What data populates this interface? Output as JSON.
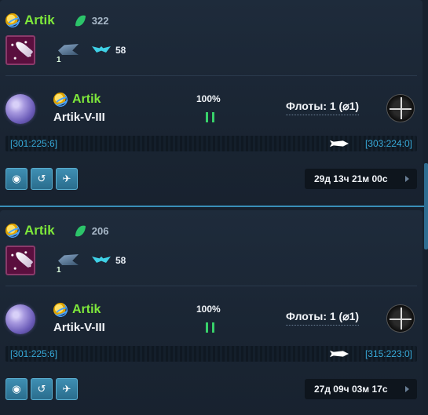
{
  "colors": {
    "owner_green": "#7ee83b",
    "coord_blue": "#37a9d8",
    "pause_green": "#38d16a",
    "action_button": "#3f8fb3",
    "separator": "#3a8fb8"
  },
  "missions": [
    {
      "owner": {
        "icon": "alliance-star-icon",
        "name": "Artik"
      },
      "resource": {
        "icon": "leaf-icon",
        "value": "322"
      },
      "badge_icon": "comet-badge-icon",
      "ship": {
        "icon": "ship-thumbnail",
        "count": "1"
      },
      "level": {
        "icon": "wings-rank-icon",
        "value": "58"
      },
      "planet": {
        "icon": "planet-icon",
        "owner": "Artik",
        "name": "Artik-V-III"
      },
      "progress": {
        "text": "100%",
        "fraction": 1.0,
        "state_icon": "pause-icon"
      },
      "fleets": {
        "label": "Флоты: 1 (⌀1)",
        "target_icon": "crosshair-target-icon"
      },
      "route": {
        "from": "[301:225:6]",
        "to": "[303:224:0]",
        "mover_icon": "rocket-icon"
      },
      "actions": [
        {
          "icon": "orbit-eye-icon",
          "glyph": "◉"
        },
        {
          "icon": "return-icon",
          "glyph": "↺"
        },
        {
          "icon": "launch-icon",
          "glyph": "✈"
        }
      ],
      "timer": "29д 13ч 21м 00с"
    },
    {
      "owner": {
        "icon": "alliance-star-icon",
        "name": "Artik"
      },
      "resource": {
        "icon": "leaf-icon",
        "value": "206"
      },
      "badge_icon": "comet-badge-icon",
      "ship": {
        "icon": "ship-thumbnail",
        "count": "1"
      },
      "level": {
        "icon": "wings-rank-icon",
        "value": "58"
      },
      "planet": {
        "icon": "planet-icon",
        "owner": "Artik",
        "name": "Artik-V-III"
      },
      "progress": {
        "text": "100%",
        "fraction": 1.0,
        "state_icon": "pause-icon"
      },
      "fleets": {
        "label": "Флоты: 1 (⌀1)",
        "target_icon": "crosshair-target-icon"
      },
      "route": {
        "from": "[301:225:6]",
        "to": "[315:223:0]",
        "mover_icon": "rocket-icon"
      },
      "actions": [
        {
          "icon": "orbit-eye-icon",
          "glyph": "◉"
        },
        {
          "icon": "return-icon",
          "glyph": "↺"
        },
        {
          "icon": "launch-icon",
          "glyph": "✈"
        }
      ],
      "timer": "27д 09ч 03м 17с"
    }
  ]
}
